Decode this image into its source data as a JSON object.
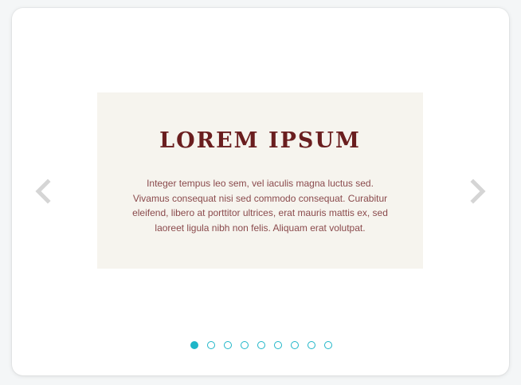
{
  "colors": {
    "title": "#6a1e1f",
    "body_text": "#8a4a4c",
    "slide_background": "#f6f4ee",
    "card_background": "#ffffff",
    "page_background": "#f4f6f7",
    "arrow": "#d5d5d5",
    "dot_accent": "#1fb6c8"
  },
  "carousel": {
    "slide": {
      "title": "LOREM IPSUM",
      "text": "Integer tempus leo sem, vel iaculis magna luctus sed. Vivamus consequat nisi sed commodo consequat. Curabitur eleifend, libero at porttitor ultrices, erat mauris mattis ex, sed laoreet ligula nibh non felis. Aliquam erat volutpat."
    },
    "prev_icon": "chevron-left-icon",
    "next_icon": "chevron-right-icon",
    "pagination": {
      "total": 9,
      "active_index": 0
    }
  }
}
